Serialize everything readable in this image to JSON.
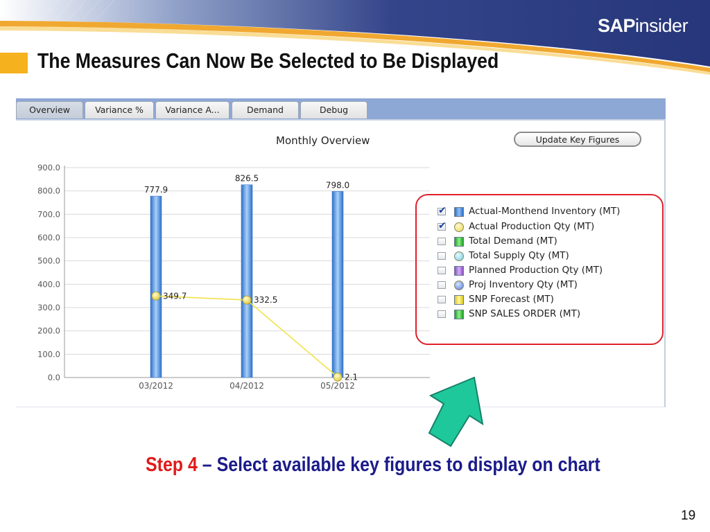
{
  "slide": {
    "title": "The Measures Can Now Be Selected to Be Displayed",
    "logo_bold": "SAP",
    "logo_light": "insider",
    "step_label": "Step 4",
    "step_text": " – Select available key figures to display on chart",
    "page_number": "19",
    "colors": {
      "accent_orange": "#f5b21e",
      "banner_navy": "#2c3b7a",
      "step_red": "#e11b1b",
      "step_navy": "#1b1b8a",
      "arrow_green": "#1ec89a"
    }
  },
  "tabs": [
    {
      "label": "Overview",
      "active": true
    },
    {
      "label": "Variance %",
      "active": false
    },
    {
      "label": "Variance A...",
      "active": false
    },
    {
      "label": "Demand",
      "active": false
    },
    {
      "label": "Debug",
      "active": false
    }
  ],
  "toolbar": {
    "update_button": "Update Key Figures"
  },
  "legend": [
    {
      "label": "Actual-Monthend Inventory (MT)",
      "checked": true,
      "swatch": "bar",
      "color": "#4b8fe0",
      "icon": "bar-swatch-icon"
    },
    {
      "label": "Actual Production Qty (MT)",
      "checked": true,
      "swatch": "circle",
      "color": "#f2e06a",
      "icon": "circle-swatch-icon"
    },
    {
      "label": "Total Demand (MT)",
      "checked": false,
      "swatch": "bar",
      "color": "#3cc43c",
      "icon": "bar-swatch-icon"
    },
    {
      "label": "Total Supply Qty (MT)",
      "checked": false,
      "swatch": "circle",
      "color": "#7fd3ea",
      "icon": "circle-swatch-icon"
    },
    {
      "label": "Planned Production Qty (MT)",
      "checked": false,
      "swatch": "bar",
      "color": "#a872d8",
      "icon": "bar-swatch-icon"
    },
    {
      "label": "Proj Inventory Qty (MT)",
      "checked": false,
      "swatch": "circle",
      "color": "#5d86e0",
      "icon": "circle-swatch-icon"
    },
    {
      "label": "SNP Forecast (MT)",
      "checked": false,
      "swatch": "bar",
      "color": "#ece83a",
      "icon": "bar-swatch-icon"
    },
    {
      "label": "SNP SALES ORDER (MT)",
      "checked": false,
      "swatch": "bar",
      "color": "#3cc43c",
      "icon": "bar-swatch-icon"
    }
  ],
  "chart_data": {
    "type": "bar",
    "title": "Monthly Overview",
    "categories": [
      "03/2012",
      "04/2012",
      "05/2012"
    ],
    "ylim": [
      0,
      900
    ],
    "yticks": [
      "0.0",
      "100.0",
      "200.0",
      "300.0",
      "400.0",
      "500.0",
      "600.0",
      "700.0",
      "800.0",
      "900.0"
    ],
    "grid": true,
    "series": [
      {
        "name": "Actual-Monthend Inventory (MT)",
        "kind": "bar",
        "values": [
          777.9,
          826.5,
          798.0
        ],
        "labels": [
          "777.9",
          "826.5",
          "798.0"
        ],
        "color": "#4b8fe0"
      },
      {
        "name": "Actual Production Qty (MT)",
        "kind": "line",
        "values": [
          349.7,
          332.5,
          2.1
        ],
        "labels": [
          "349.7",
          "332.5",
          "2.1"
        ],
        "color": "#f2e06a"
      }
    ]
  }
}
